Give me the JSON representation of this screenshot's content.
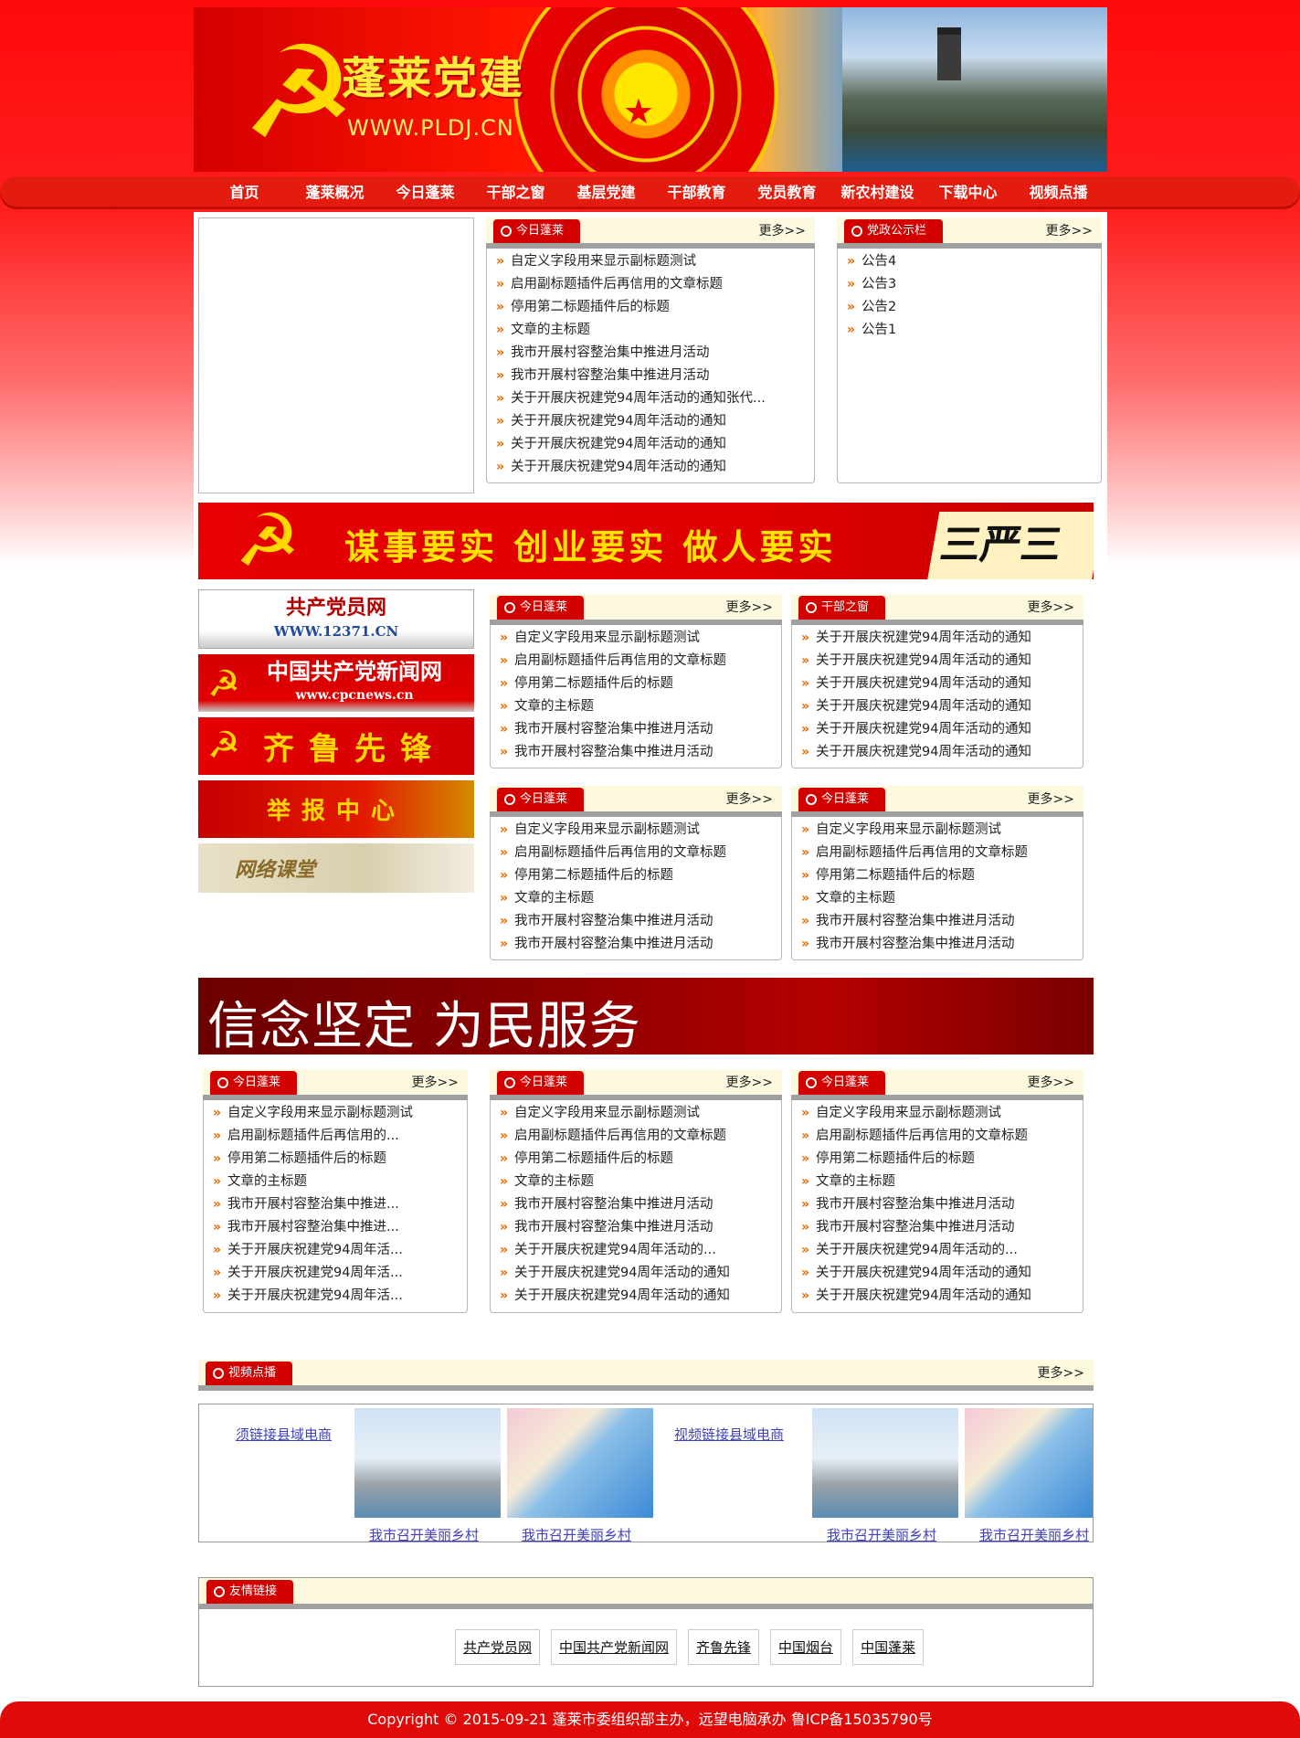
{
  "banner": {
    "title": "蓬莱党建",
    "url": "WWW.PLDJ.CN"
  },
  "nav": [
    "首页",
    "蓬莱概况",
    "今日蓬莱",
    "干部之窗",
    "基层党建",
    "干部教育",
    "党员教育",
    "新农村建设",
    "下载中心",
    "视频点播"
  ],
  "more_label": "更多>>",
  "top": {
    "today": {
      "title": "今日蓬莱",
      "items": [
        "自定义字段用来显示副标题测试",
        "启用副标题插件后再信用的文章标题",
        "停用第二标题插件后的标题",
        "文章的主标题",
        "我市开展村容整治集中推进月活动",
        "我市开展村容整治集中推进月活动",
        "关于开展庆祝建党94周年活动的通知张代...",
        "关于开展庆祝建党94周年活动的通知",
        "关于开展庆祝建党94周年活动的通知",
        "关于开展庆祝建党94周年活动的通知"
      ]
    },
    "notice": {
      "title": "党政公示栏",
      "items": [
        "公告4",
        "公告3",
        "公告2",
        "公告1"
      ]
    }
  },
  "slogan1": {
    "text": "谋事要实  创业要实  做人要实",
    "calligraphy": "三严三实"
  },
  "side_links": [
    {
      "label": "共产党员网",
      "sub": "WWW.12371.CN"
    },
    {
      "label": "中国共产党新闻网",
      "sub": "www.cpcnews.cn"
    },
    {
      "label": "齐鲁先锋",
      "sub": ""
    },
    {
      "label": "举报中心",
      "sub": ""
    },
    {
      "label": "网络课堂",
      "sub": ""
    }
  ],
  "mid": [
    {
      "title": "今日蓬莱",
      "items": [
        "自定义字段用来显示副标题测试",
        "启用副标题插件后再信用的文章标题",
        "停用第二标题插件后的标题",
        "文章的主标题",
        "我市开展村容整治集中推进月活动",
        "我市开展村容整治集中推进月活动"
      ]
    },
    {
      "title": "干部之窗",
      "items": [
        "关于开展庆祝建党94周年活动的通知",
        "关于开展庆祝建党94周年活动的通知",
        "关于开展庆祝建党94周年活动的通知",
        "关于开展庆祝建党94周年活动的通知",
        "关于开展庆祝建党94周年活动的通知",
        "关于开展庆祝建党94周年活动的通知"
      ]
    },
    {
      "title": "今日蓬莱",
      "items": [
        "自定义字段用来显示副标题测试",
        "启用副标题插件后再信用的文章标题",
        "停用第二标题插件后的标题",
        "文章的主标题",
        "我市开展村容整治集中推进月活动",
        "我市开展村容整治集中推进月活动"
      ]
    },
    {
      "title": "今日蓬莱",
      "items": [
        "自定义字段用来显示副标题测试",
        "启用副标题插件后再信用的文章标题",
        "停用第二标题插件后的标题",
        "文章的主标题",
        "我市开展村容整治集中推进月活动",
        "我市开展村容整治集中推进月活动"
      ]
    }
  ],
  "slogan2": {
    "text": "信念坚定 为民服务"
  },
  "bottom": [
    {
      "title": "今日蓬莱",
      "items": [
        "自定义字段用来显示副标题测试",
        "启用副标题插件后再信用的...",
        "停用第二标题插件后的标题",
        "文章的主标题",
        "我市开展村容整治集中推进...",
        "我市开展村容整治集中推进...",
        "关于开展庆祝建党94周年活...",
        "关于开展庆祝建党94周年活...",
        "关于开展庆祝建党94周年活..."
      ]
    },
    {
      "title": "今日蓬莱",
      "items": [
        "自定义字段用来显示副标题测试",
        "启用副标题插件后再信用的文章标题",
        "停用第二标题插件后的标题",
        "文章的主标题",
        "我市开展村容整治集中推进月活动",
        "我市开展村容整治集中推进月活动",
        "关于开展庆祝建党94周年活动的...",
        "关于开展庆祝建党94周年活动的通知",
        "关于开展庆祝建党94周年活动的通知"
      ]
    },
    {
      "title": "今日蓬莱",
      "items": [
        "自定义字段用来显示副标题测试",
        "启用副标题插件后再信用的文章标题",
        "停用第二标题插件后的标题",
        "文章的主标题",
        "我市开展村容整治集中推进月活动",
        "我市开展村容整治集中推进月活动",
        "关于开展庆祝建党94周年活动的...",
        "关于开展庆祝建党94周年活动的通知",
        "关于开展庆祝建党94周年活动的通知"
      ]
    }
  ],
  "video": {
    "title": "视频点播",
    "link_a": "须链接县域电商",
    "link_b": "视频链接县域电商",
    "captions": [
      "我市召开美丽乡村",
      "我市召开美丽乡村",
      "我市召开美丽乡村",
      "我市召开美丽乡村"
    ]
  },
  "friends": {
    "title": "友情链接",
    "links": [
      "共产党员网",
      "中国共产党新闻网",
      "齐鲁先锋",
      "中国烟台",
      "中国蓬莱"
    ]
  },
  "footer": "Copyright © 2015-09-21 蓬莱市委组织部主办，远望电脑承办 鲁ICP备15035790号",
  "colors": {
    "primary": "#e31c0f",
    "tab": "#d30000",
    "arrow": "#e06a00",
    "link": "#4040c0"
  }
}
